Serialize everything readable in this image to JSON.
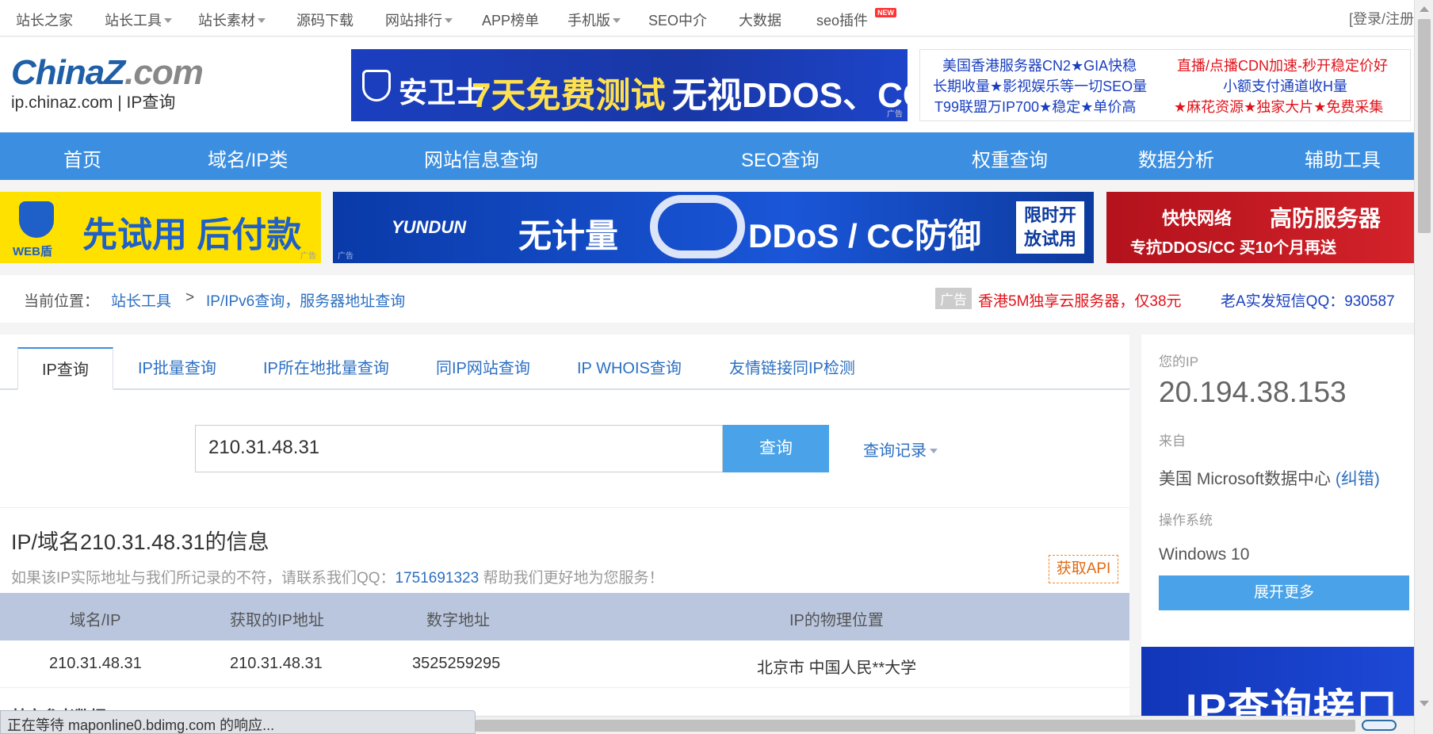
{
  "topbar": {
    "items": [
      {
        "label": "站长之家"
      },
      {
        "label": "站长工具"
      },
      {
        "label": "站长素材"
      },
      {
        "label": "源码下载"
      },
      {
        "label": "网站排行"
      },
      {
        "label": "APP榜单"
      },
      {
        "label": "手机版"
      },
      {
        "label": "SEO中介"
      },
      {
        "label": "大数据"
      },
      {
        "label": "seo插件"
      }
    ],
    "new_badge": "NEW",
    "login": "[登录/注册"
  },
  "logo": {
    "main_left": "China",
    "main_z": "Z",
    "main_right": ".com",
    "sub": "ip.chinaz.com | IP查询"
  },
  "header_banner": {
    "brand": "安卫士",
    "highlight": "7天免费测试",
    "tail": "无视DDOS、CC",
    "ad_tag": "广告"
  },
  "text_ads": {
    "left": [
      "美国香港服务器CN2★GIA快稳",
      "长期收量★影视娱乐等一切SEO量",
      "T99联盟万IP700★稳定★单价高"
    ],
    "right": [
      "直播/点播CDN加速-秒开稳定价好",
      "小额支付通道收H量",
      "★麻花资源★独家大片★免费采集"
    ]
  },
  "mainnav": {
    "items": [
      {
        "label": "首页"
      },
      {
        "label": "域名/IP类"
      },
      {
        "label": "网站信息查询"
      },
      {
        "label": "SEO查询"
      },
      {
        "label": "权重查询"
      },
      {
        "label": "数据分析"
      },
      {
        "label": "辅助工具"
      }
    ]
  },
  "banners": {
    "b1_brand": "WEB盾",
    "b1_text": "先试用 后付款",
    "b2_brand": "YUNDUN",
    "b2_text1": "无计量",
    "b2_text2": "DDoS / CC防御",
    "b2_text3a": "限时开",
    "b2_text3b": "放试用",
    "b3_brand": "快快网络",
    "b3_text1": "高防服务器",
    "b3_text2": "专抗DDOS/CC  买10个月再送",
    "ad_tag": "广告"
  },
  "breadcrumb": {
    "prefix": "当前位置：",
    "level1": "站长工具",
    "arrow": ">",
    "level2": "IP/IPv6查询，服务器地址查询",
    "ad_tag": "广告",
    "ad_text": "香港5M独享云服务器，仅38元",
    "ad_qq": "老A实发短信QQ：930587"
  },
  "tabs": [
    {
      "label": "IP查询"
    },
    {
      "label": "IP批量查询"
    },
    {
      "label": "IP所在地批量查询"
    },
    {
      "label": "同IP网站查询"
    },
    {
      "label": "IP WHOIS查询"
    },
    {
      "label": "友情链接同IP检测"
    }
  ],
  "search": {
    "value": "210.31.48.31",
    "button": "查询",
    "history": "查询记录"
  },
  "info": {
    "title": "IP/域名210.31.48.31的信息",
    "note_prefix": "如果该IP实际地址与我们所记录的不符，请联系我们QQ：",
    "note_qq": "1751691323",
    "note_suffix": " 帮助我们更好地为您服务！",
    "api_button": "获取API"
  },
  "table": {
    "headers": [
      "域名/IP",
      "获取的IP地址",
      "数字地址",
      "IP的物理位置"
    ],
    "rows": [
      [
        "210.31.48.31",
        "210.31.48.31",
        "3525259295",
        "北京市 中国人民**大学"
      ]
    ],
    "more": "其它参考数据"
  },
  "sidebar": {
    "ip_label": "您的IP",
    "ip": "20.194.38.153",
    "from_label": "来自",
    "from": "美国 Microsoft数据中心",
    "correct": "(纠错)",
    "os_label": "操作系统",
    "os": "Windows 10",
    "expand": "展开更多",
    "ad": "IP查询接口"
  },
  "status": "正在等待 maponline0.bdimg.com 的响应..."
}
